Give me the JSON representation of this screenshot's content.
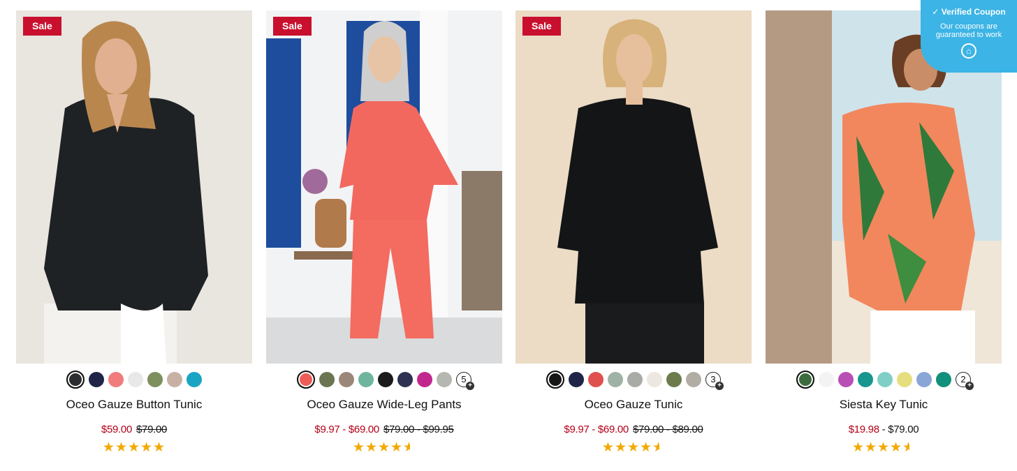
{
  "products": [
    {
      "sale_badge": "Sale",
      "name": "Oceo Gauze Button Tunic",
      "price_sale": "$59.00",
      "price_dash": "",
      "price_current": "",
      "price_original": "$79.00",
      "rating": 5,
      "swatches": [
        "#2b2d30",
        "#1f2547",
        "#f07c7c",
        "#e8e8e8",
        "#7d8f5c",
        "#c8b1a4",
        "#1aa4c4"
      ],
      "selected_swatch": 0,
      "more_count": "",
      "photo": {
        "bg": "#e9e5df",
        "figure": "#1f2224",
        "skin": "#e0b090"
      }
    },
    {
      "sale_badge": "Sale",
      "name": "Oceo Gauze Wide-Leg Pants",
      "price_sale": "$9.97 - $69.00",
      "price_dash": "",
      "price_current": "",
      "price_original": "$79.00 - $99.95",
      "rating": 4.5,
      "swatches": [
        "#ef5b57",
        "#6b7552",
        "#9b8779",
        "#6fb59e",
        "#1b1b1b",
        "#2d3253",
        "#c2278d",
        "#b5b8b0"
      ],
      "selected_swatch": 0,
      "more_count": "5",
      "photo": {
        "bg": "#f2f3f5",
        "figure": "#f2685f",
        "skin": "#e8c4a6"
      }
    },
    {
      "sale_badge": "Sale",
      "name": "Oceo Gauze Tunic",
      "price_sale": "$9.97 - $69.00",
      "price_dash": "",
      "price_current": "",
      "price_original": "$79.00 - $89.00",
      "rating": 4.5,
      "swatches": [
        "#161616",
        "#1f2547",
        "#e0504f",
        "#9fb3a4",
        "#a9aba6",
        "#ece7e0",
        "#6d7a4c",
        "#b2ada4"
      ],
      "selected_swatch": 0,
      "more_count": "3",
      "photo": {
        "bg": "#ecdcc6",
        "figure": "#141517",
        "skin": "#e6bf9c"
      }
    },
    {
      "sale_badge": "",
      "name": "Siesta Key Tunic",
      "price_sale": "$19.98",
      "price_dash": " - ",
      "price_current": "$79.00",
      "price_original": "",
      "rating": 4.5,
      "swatches": [
        "#3c6c3e",
        "#f3f3f3",
        "#b84fb5",
        "#17968e",
        "#7fcfc6",
        "#e6de7e",
        "#8aa6d6",
        "#11907c"
      ],
      "selected_swatch": 0,
      "more_count": "2",
      "photo": {
        "bg": "#cfe3ea",
        "figure": "#f2875d",
        "skin": "#c98e68"
      }
    }
  ],
  "coupon": {
    "title": "Verified Coupon",
    "line1": "Our coupons are",
    "line2": "guaranteed to work",
    "accent": "#3cb4e5"
  },
  "colors": {
    "sale_badge": "#c8102e",
    "sale_price": "#b40019",
    "star": "#f2a900"
  },
  "icons": {
    "plus": "plus-icon",
    "coupon": "badge-icon",
    "check": "check-icon"
  }
}
